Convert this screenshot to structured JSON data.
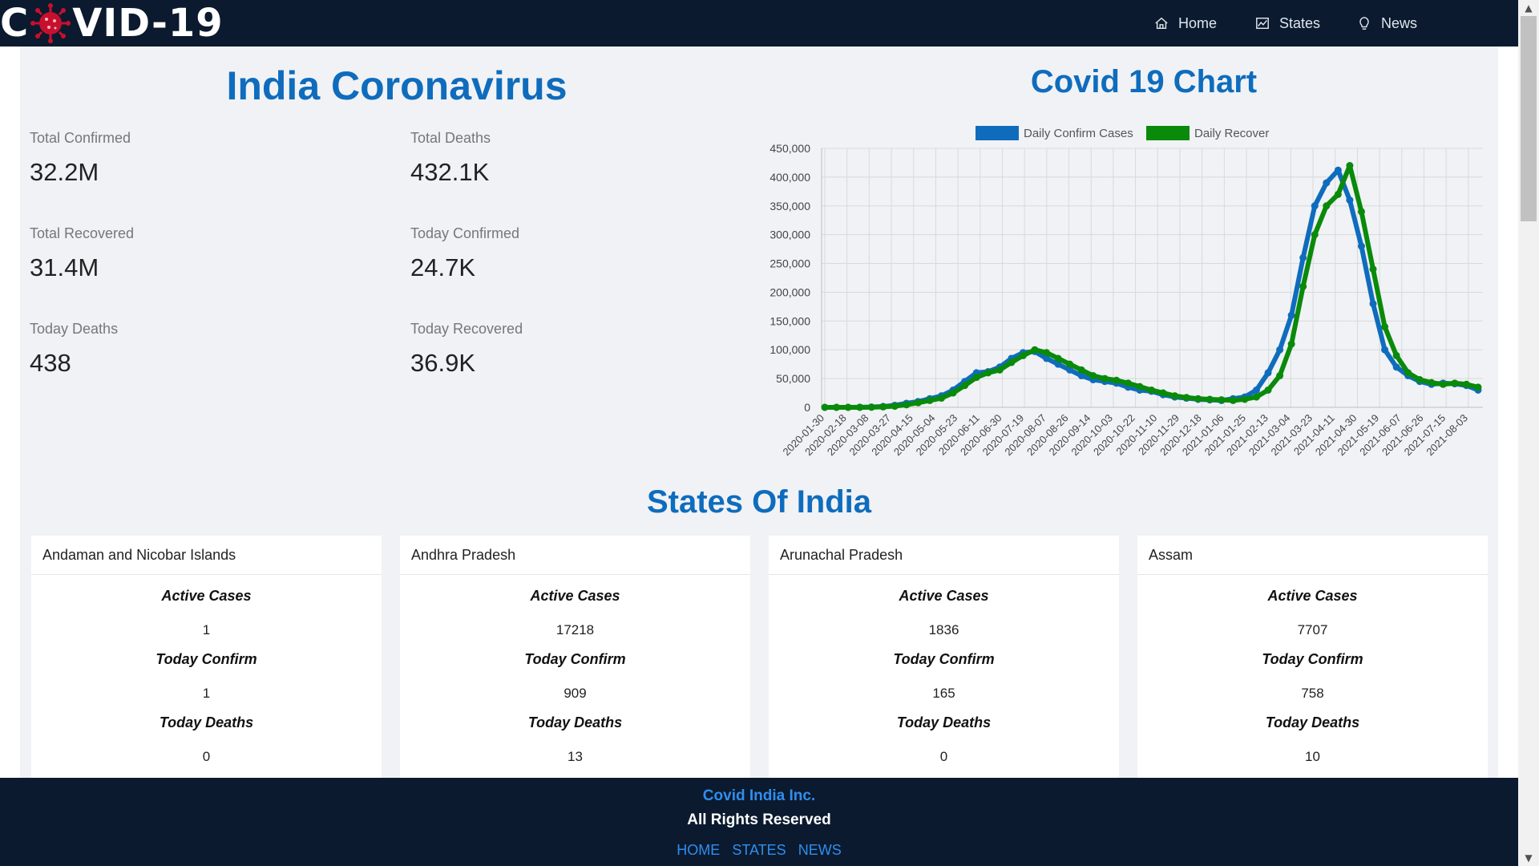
{
  "brand": {
    "text_left": "C",
    "text_right": "VID-19",
    "icon": "virus-icon"
  },
  "nav": {
    "items": [
      {
        "label": "Home",
        "icon": "home-icon"
      },
      {
        "label": "States",
        "icon": "chart-icon"
      },
      {
        "label": "News",
        "icon": "lightbulb-icon"
      }
    ]
  },
  "india": {
    "title": "India Coronavirus",
    "stats": [
      {
        "label": "Total Confirmed",
        "value": "32.2M"
      },
      {
        "label": "Total Deaths",
        "value": "432.1K"
      },
      {
        "label": "Total Recovered",
        "value": "31.4M"
      },
      {
        "label": "Today Confirmed",
        "value": "24.7K"
      },
      {
        "label": "Today Deaths",
        "value": "438"
      },
      {
        "label": "Today Recovered",
        "value": "36.9K"
      }
    ]
  },
  "chart": {
    "title": "Covid 19 Chart"
  },
  "chart_data": {
    "type": "line",
    "legend_position": "top",
    "grid": true,
    "ylim": [
      0,
      450000
    ],
    "yticks": [
      0,
      50000,
      100000,
      150000,
      200000,
      250000,
      300000,
      350000,
      400000,
      450000
    ],
    "xticks": [
      "2020-01-30",
      "2020-02-18",
      "2020-03-08",
      "2020-03-27",
      "2020-04-15",
      "2020-05-04",
      "2020-05-23",
      "2020-06-11",
      "2020-06-30",
      "2020-07-19",
      "2020-08-07",
      "2020-08-26",
      "2020-09-14",
      "2020-10-03",
      "2020-10-22",
      "2020-11-10",
      "2020-11-29",
      "2020-12-18",
      "2021-01-06",
      "2021-01-25",
      "2021-02-13",
      "2021-03-04",
      "2021-03-23",
      "2021-04-11",
      "2021-04-30",
      "2021-05-19",
      "2021-06-07",
      "2021-06-26",
      "2021-07-15",
      "2021-08-03"
    ],
    "series": [
      {
        "name": "Daily Confirm Cases",
        "color": "#0f6cbd",
        "values": [
          0,
          0,
          0,
          100,
          500,
          1500,
          3500,
          7000,
          10000,
          15000,
          20000,
          30000,
          45000,
          60000,
          62000,
          70000,
          85000,
          95000,
          97000,
          85000,
          75000,
          65000,
          55000,
          48000,
          45000,
          42000,
          35000,
          30000,
          28000,
          22000,
          18000,
          16000,
          14000,
          13000,
          12000,
          15000,
          18000,
          30000,
          60000,
          100000,
          160000,
          260000,
          350000,
          390000,
          412000,
          360000,
          280000,
          180000,
          100000,
          70000,
          55000,
          45000,
          40000,
          42000,
          41000,
          38000,
          30000
        ]
      },
      {
        "name": "Daily Recover",
        "color": "#0a8a0a",
        "values": [
          0,
          0,
          0,
          0,
          200,
          800,
          2000,
          4500,
          8000,
          12000,
          16000,
          25000,
          38000,
          52000,
          60000,
          65000,
          78000,
          90000,
          100000,
          95000,
          85000,
          75000,
          65000,
          55000,
          50000,
          47000,
          42000,
          36000,
          30000,
          25000,
          20000,
          17000,
          15000,
          14000,
          13000,
          12000,
          14000,
          18000,
          30000,
          55000,
          110000,
          210000,
          300000,
          350000,
          370000,
          420000,
          340000,
          240000,
          140000,
          90000,
          60000,
          48000,
          43000,
          40000,
          42000,
          40000,
          35000
        ]
      }
    ]
  },
  "states": {
    "title": "States Of India",
    "labels": {
      "active": "Active Cases",
      "confirm": "Today Confirm",
      "deaths": "Today Deaths"
    },
    "cards": [
      {
        "name": "Andaman and Nicobar Islands",
        "active": "1",
        "confirm": "1",
        "deaths": "0"
      },
      {
        "name": "Andhra Pradesh",
        "active": "17218",
        "confirm": "909",
        "deaths": "13"
      },
      {
        "name": "Arunachal Pradesh",
        "active": "1836",
        "confirm": "165",
        "deaths": "0"
      },
      {
        "name": "Assam",
        "active": "7707",
        "confirm": "758",
        "deaths": "10"
      }
    ]
  },
  "footer": {
    "company": "Covid India Inc.",
    "rights": "All Rights Reserved",
    "links": [
      "HOME",
      "STATES",
      "NEWS"
    ]
  }
}
